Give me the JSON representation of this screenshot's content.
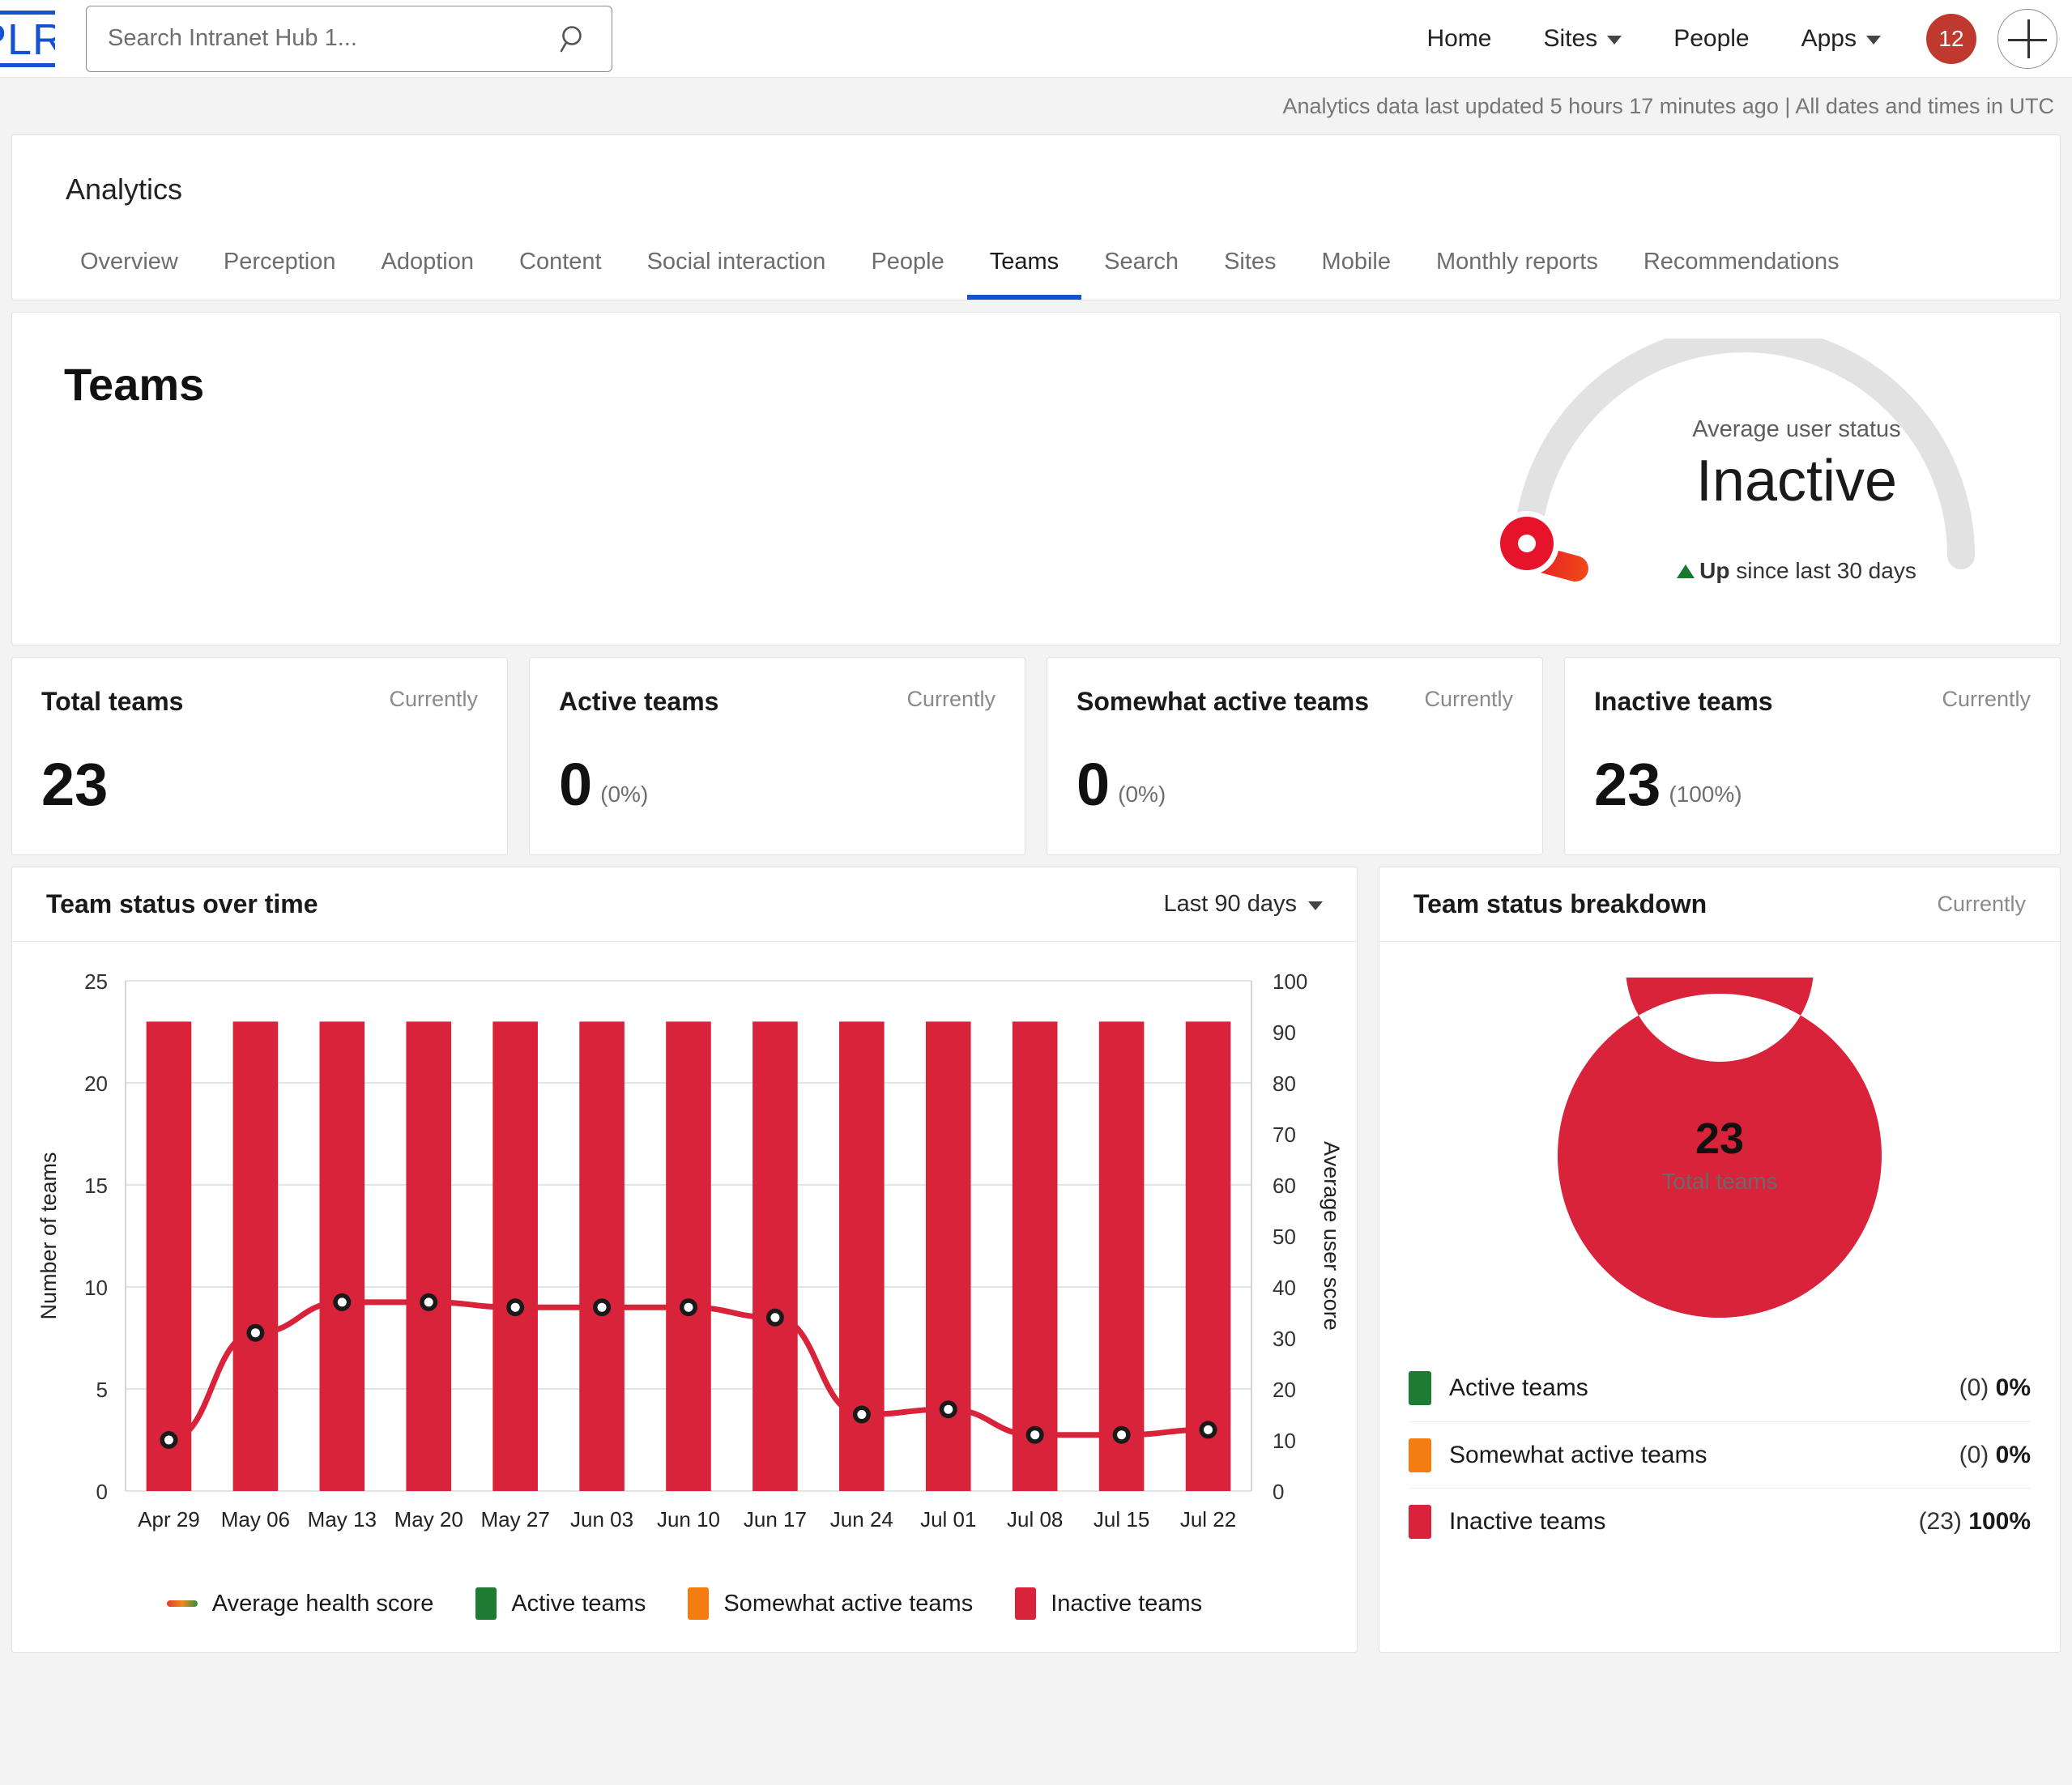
{
  "header": {
    "logo_text": "PLR",
    "search": {
      "placeholder": "Search Intranet Hub 1...",
      "value": "",
      "icon": "search-icon"
    },
    "nav": [
      {
        "label": "Home",
        "caret": false
      },
      {
        "label": "Sites",
        "caret": true
      },
      {
        "label": "People",
        "caret": false
      },
      {
        "label": "Apps",
        "caret": true
      }
    ],
    "badge_count": "12",
    "add_icon": "plus-icon"
  },
  "update_strip": "Analytics data last updated 5 hours 17 minutes ago | All dates and times in UTC",
  "analytics": {
    "title": "Analytics",
    "tabs": [
      {
        "label": "Overview",
        "active": false
      },
      {
        "label": "Perception",
        "active": false
      },
      {
        "label": "Adoption",
        "active": false
      },
      {
        "label": "Content",
        "active": false
      },
      {
        "label": "Social interaction",
        "active": false
      },
      {
        "label": "People",
        "active": false
      },
      {
        "label": "Teams",
        "active": true
      },
      {
        "label": "Search",
        "active": false
      },
      {
        "label": "Sites",
        "active": false
      },
      {
        "label": "Mobile",
        "active": false
      },
      {
        "label": "Monthly reports",
        "active": false
      },
      {
        "label": "Recommendations",
        "active": false
      }
    ]
  },
  "hero": {
    "title": "Teams",
    "gauge": {
      "label": "Average user status",
      "value": "Inactive",
      "trend_direction": "Up",
      "trend_suffix": " since last 30 days",
      "needle_position_pct": 3,
      "track_color": "#e2e2e2",
      "needle_color": "#e5142b"
    }
  },
  "kpis": [
    {
      "title": "Total teams",
      "when": "Currently",
      "value": "23",
      "pct": ""
    },
    {
      "title": "Active teams",
      "when": "Currently",
      "value": "0",
      "pct": "(0%)"
    },
    {
      "title": "Somewhat active teams",
      "when": "Currently",
      "value": "0",
      "pct": "(0%)"
    },
    {
      "title": "Inactive teams",
      "when": "Currently",
      "value": "23",
      "pct": "(100%)"
    }
  ],
  "chart_panel": {
    "title": "Team status over time",
    "range_label": "Last 90 days",
    "legend": [
      {
        "label": "Average health score",
        "type": "line",
        "color": "#d9233b"
      },
      {
        "label": "Active teams",
        "type": "swatch",
        "color": "#1e7b34"
      },
      {
        "label": "Somewhat active teams",
        "type": "swatch",
        "color": "#f57c10"
      },
      {
        "label": "Inactive teams",
        "type": "swatch",
        "color": "#d9233b"
      }
    ]
  },
  "donut_panel": {
    "title": "Team status breakdown",
    "when": "Currently",
    "center_value": "23",
    "center_label": "Total teams",
    "rows": [
      {
        "label": "Active teams",
        "count": "(0)",
        "pct": "0%",
        "color": "#1e7b34"
      },
      {
        "label": "Somewhat active teams",
        "count": "(0)",
        "pct": "0%",
        "color": "#f57c10"
      },
      {
        "label": "Inactive teams",
        "count": "(23)",
        "pct": "100%",
        "color": "#d9233b"
      }
    ]
  },
  "chart_data": [
    {
      "type": "bar",
      "title": "Team status over time",
      "xlabel": "",
      "ylabel": "Number of teams",
      "y2label": "Average user score",
      "ylim": [
        0,
        25
      ],
      "y2lim": [
        0,
        100
      ],
      "yticks": [
        0,
        5,
        10,
        15,
        20,
        25
      ],
      "y2ticks": [
        0,
        10,
        20,
        30,
        40,
        50,
        60,
        70,
        80,
        90,
        100
      ],
      "grid": true,
      "legend_position": "bottom",
      "categories": [
        "Apr 29",
        "May 06",
        "May 13",
        "May 20",
        "May 27",
        "Jun 03",
        "Jun 10",
        "Jun 17",
        "Jun 24",
        "Jul 01",
        "Jul 08",
        "Jul 15",
        "Jul 22"
      ],
      "series": [
        {
          "name": "Active teams",
          "axis": "left",
          "type": "bar",
          "color": "#1e7b34",
          "values": [
            0,
            0,
            0,
            0,
            0,
            0,
            0,
            0,
            0,
            0,
            0,
            0,
            0
          ]
        },
        {
          "name": "Somewhat active teams",
          "axis": "left",
          "type": "bar",
          "color": "#f57c10",
          "values": [
            0,
            0,
            0,
            0,
            0,
            0,
            0,
            0,
            0,
            0,
            0,
            0,
            0
          ]
        },
        {
          "name": "Inactive teams",
          "axis": "left",
          "type": "bar",
          "color": "#d9233b",
          "values": [
            23,
            23,
            23,
            23,
            23,
            23,
            23,
            23,
            23,
            23,
            23,
            23,
            23
          ]
        },
        {
          "name": "Average health score",
          "axis": "right",
          "type": "line",
          "color": "#d9233b",
          "values": [
            10,
            31,
            37,
            37,
            36,
            36,
            36,
            34,
            15,
            16,
            11,
            11,
            12
          ]
        }
      ]
    },
    {
      "type": "pie",
      "title": "Team status breakdown",
      "subtype": "donut",
      "center_value": 23,
      "center_label": "Total teams",
      "labels": [
        "Active teams",
        "Somewhat active teams",
        "Inactive teams"
      ],
      "values": [
        0,
        0,
        23
      ],
      "percents": [
        0,
        0,
        100
      ],
      "colors": [
        "#1e7b34",
        "#f57c10",
        "#d9233b"
      ]
    },
    {
      "type": "gauge",
      "title": "Average user status",
      "value_label": "Inactive",
      "range": [
        0,
        100
      ],
      "value": 3,
      "color": "#e5142b",
      "track_color": "#e2e2e2"
    }
  ]
}
